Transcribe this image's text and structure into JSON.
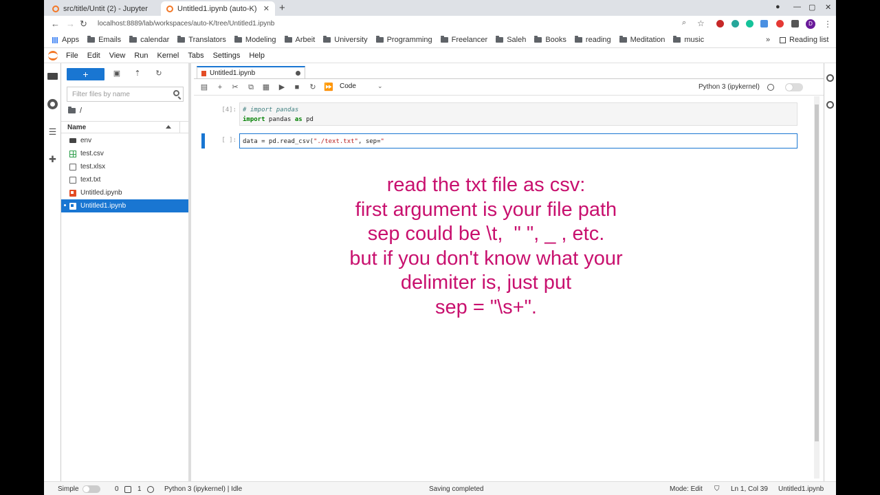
{
  "browser": {
    "tabs": [
      {
        "title": "src/title/Untit (2) - Jupyter",
        "active": false
      },
      {
        "title": "Untitled1.ipynb (auto-K)",
        "active": true
      }
    ],
    "new_tab": "+",
    "address": "localhost:8889/lab/workspaces/auto-K/tree/Untitled1.ipynb",
    "bookmarks": [
      "Emails",
      "calendar",
      "Translators",
      "Modeling",
      "Arbeit",
      "University",
      "Programming",
      "Freelancer",
      "Saleh",
      "Books",
      "reading",
      "Meditation",
      "music"
    ],
    "apps_label": "Apps",
    "more": "»",
    "reading_list": "Reading list",
    "profile_initial": "D"
  },
  "menu": [
    "File",
    "Edit",
    "View",
    "Run",
    "Kernel",
    "Tabs",
    "Settings",
    "Help"
  ],
  "filebrowser": {
    "new_label": "+",
    "filter_placeholder": "Filter files by name",
    "breadcrumb": "/",
    "column_name": "Name",
    "files": [
      {
        "name": "env",
        "type": "folder"
      },
      {
        "name": "test.csv",
        "type": "csv"
      },
      {
        "name": "test.xlsx",
        "type": "doc"
      },
      {
        "name": "text.txt",
        "type": "doc"
      },
      {
        "name": "Untitled.ipynb",
        "type": "notebook"
      },
      {
        "name": "Untitled1.ipynb",
        "type": "notebook",
        "selected": true
      }
    ]
  },
  "notebook": {
    "tab_title": "Untitled1.ipynb",
    "cell_type": "Code",
    "kernel": "Python 3 (ipykernel)",
    "cells": [
      {
        "prompt": "[4]:",
        "line1_comment": "# import pandas",
        "line2_kw1": "import",
        "line2_mid": " pandas ",
        "line2_kw2": "as",
        "line2_end": " pd"
      },
      {
        "prompt": "[ ]:",
        "code_pre": "data = pd.read_csv(",
        "code_str": "\"./text.txt\"",
        "code_mid": ", sep=",
        "code_str2": "\""
      }
    ]
  },
  "overlay_text": [
    "read the txt file as csv:",
    "first argument is your file path",
    "sep could be \\t,  \" \", _ , etc.",
    "but if you don't know what your",
    "delimiter is, just put",
    "sep = \"\\s+\"."
  ],
  "status": {
    "simple": "Simple",
    "terminals": "0",
    "kernels": "1",
    "kernel_status": "Python 3 (ipykernel) | Idle",
    "message": "Saving completed",
    "mode": "Mode: Edit",
    "position": "Ln 1, Col 39",
    "filename": "Untitled1.ipynb"
  },
  "colors": {
    "accent": "#1976d2",
    "overlay": "#c8106e",
    "jupyter_orange": "#f37726"
  }
}
